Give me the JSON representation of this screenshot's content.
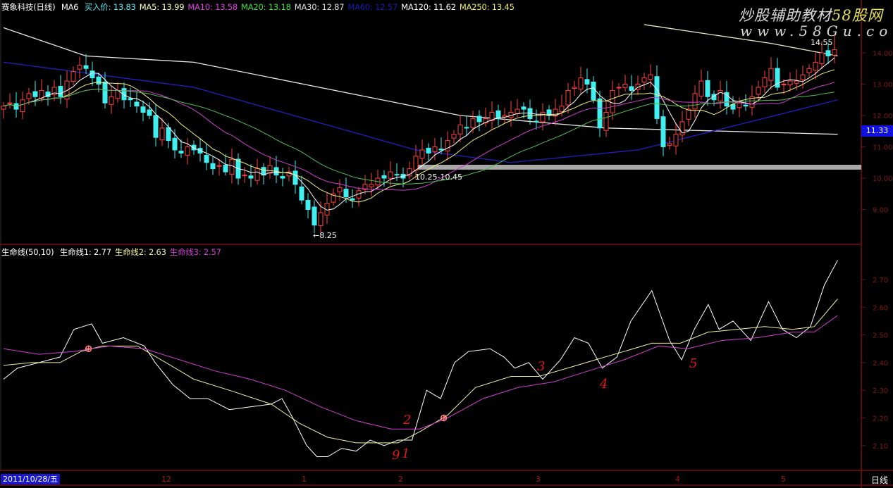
{
  "header": {
    "stock": "赛象科技(日线)",
    "indicator": "MA6",
    "items": [
      {
        "label": "买入价: 13.83",
        "color": "#60e8f0"
      },
      {
        "label": "MA5: 13.99",
        "color": "#ffffb0"
      },
      {
        "label": "MA10: 13.58",
        "color": "#e040e0"
      },
      {
        "label": "MA20: 13.18",
        "color": "#40e040"
      },
      {
        "label": "MA30: 12.87",
        "color": "#e0e0e0"
      },
      {
        "label": "MA60: 12.57",
        "color": "#1a1ab0"
      },
      {
        "label": "MA120: 11.62",
        "color": "#ffffff"
      },
      {
        "label": "MA250: 13.45",
        "color": "#f0f060"
      }
    ]
  },
  "lower_header": {
    "name": "生命线(50,10)",
    "items": [
      {
        "label": "生命线1: 2.77",
        "color": "#ffffff"
      },
      {
        "label": "生命线2: 2.63",
        "color": "#f0f0a0"
      },
      {
        "label": "生命线3: 2.57",
        "color": "#d040d0"
      }
    ]
  },
  "watermark": {
    "line1a": "炒股辅助教材",
    "line1b": "58股网",
    "line2": "www.58Gu.com"
  },
  "annotations": {
    "low_price": "←8.25",
    "high_price": "14.55",
    "band": "10.25-10.45",
    "last_price": "11.33",
    "marks": [
      "9",
      "1",
      "2",
      "3",
      "4",
      "5"
    ]
  },
  "bottom": {
    "date": "2011/10/28/五",
    "months": [
      "12",
      "1",
      "2",
      "3",
      "4",
      "5"
    ],
    "period": "日线"
  },
  "chart_data": [
    {
      "type": "candlestick",
      "title": "赛象科技(日线)",
      "ylim": [
        7.9,
        15.2
      ],
      "yticks": [
        "14.00",
        "13.00",
        "12.00",
        "11.00",
        "10.00",
        "9.00"
      ],
      "close": [
        12.3,
        12.4,
        12.2,
        12.5,
        12.7,
        12.6,
        12.8,
        12.6,
        12.9,
        12.6,
        13.1,
        13.4,
        13.6,
        13.5,
        13.2,
        13.0,
        12.4,
        12.6,
        12.8,
        12.5,
        12.5,
        12.3,
        12.1,
        12.0,
        11.3,
        11.6,
        11.2,
        10.9,
        10.8,
        11.0,
        10.9,
        10.8,
        10.5,
        10.3,
        10.4,
        10.2,
        10.6,
        10.0,
        10.1,
        10.0,
        10.3,
        10.1,
        10.4,
        10.1,
        10.0,
        10.2,
        9.8,
        9.3,
        9.0,
        8.5,
        8.9,
        9.2,
        9.5,
        9.7,
        9.4,
        9.3,
        9.6,
        9.8,
        9.8,
        10.0,
        10.0,
        10.2,
        10.1,
        10.0,
        10.3,
        10.7,
        10.9,
        10.8,
        11.0,
        10.9,
        11.2,
        11.4,
        11.7,
        11.6,
        11.9,
        11.8,
        11.9,
        12.1,
        11.9,
        12.0,
        12.1,
        12.2,
        12.2,
        11.9,
        11.8,
        12.1,
        12.0,
        12.2,
        12.3,
        12.8,
        12.9,
        13.2,
        13.0,
        12.5,
        11.6,
        12.1,
        12.8,
        12.9,
        13.0,
        12.8,
        13.0,
        13.2,
        13.3,
        11.9,
        11.0,
        11.1,
        11.4,
        11.8,
        12.2,
        12.7,
        13.1,
        12.6,
        12.5,
        12.8,
        12.3,
        12.2,
        12.4,
        12.3,
        12.6,
        12.9,
        13.2,
        13.5,
        12.9,
        13.0,
        13.1,
        13.1,
        13.3,
        13.5,
        13.7,
        14.0,
        13.9,
        14.1
      ],
      "ma_periods": [
        5,
        10,
        20,
        30
      ],
      "ma_colors": [
        "#ffffff",
        "#f0f080",
        "#d040d0",
        "#50c050"
      ],
      "long_lines": [
        {
          "name": "MA120",
          "color": "#e8e8e8",
          "points": [
            [
              0,
              14.8
            ],
            [
              13,
              13.9
            ],
            [
              30,
              13.7
            ],
            [
              72,
              12.0
            ],
            [
              95,
              11.6
            ],
            [
              131.5,
              11.4
            ]
          ]
        },
        {
          "name": "MA250",
          "color": "#e8e8c0",
          "points": [
            [
              101,
              14.9
            ],
            [
              121,
              14.3
            ],
            [
              131.5,
              13.9
            ]
          ]
        },
        {
          "name": "MA60",
          "color": "#2020c0",
          "points": [
            [
              0,
              13.7
            ],
            [
              30,
              12.9
            ],
            [
              65,
              10.9
            ],
            [
              80,
              10.5
            ],
            [
              100,
              10.9
            ],
            [
              131.5,
              12.5
            ]
          ]
        }
      ],
      "band": {
        "from": 10.25,
        "to": 10.45,
        "start_index": 65
      },
      "low": {
        "index": 49,
        "value": 8.25
      },
      "high": {
        "index": 131,
        "value": 14.55
      }
    },
    {
      "type": "line",
      "title": "生命线(50,10)",
      "ylim": [
        2.0,
        2.82
      ],
      "yticks": [
        "2.70",
        "2.60",
        "2.50",
        "2.40",
        "2.30",
        "2.20",
        "2.10"
      ],
      "series": [
        {
          "name": "生命线1",
          "color": "#ffffff",
          "points": [
            [
              0,
              2.34
            ],
            [
              2.2,
              2.38
            ],
            [
              5.6,
              2.4
            ],
            [
              8.9,
              2.42
            ],
            [
              11.1,
              2.52
            ],
            [
              13.9,
              2.54
            ],
            [
              15.6,
              2.47
            ],
            [
              18.9,
              2.49
            ],
            [
              22.2,
              2.46
            ],
            [
              23.9,
              2.4
            ],
            [
              26.7,
              2.32
            ],
            [
              29.4,
              2.27
            ],
            [
              32.2,
              2.27
            ],
            [
              35.6,
              2.23
            ],
            [
              38.9,
              2.24
            ],
            [
              42.2,
              2.25
            ],
            [
              43.9,
              2.27
            ],
            [
              45.6,
              2.2
            ],
            [
              47.8,
              2.1
            ],
            [
              49.4,
              2.06
            ],
            [
              51.1,
              2.06
            ],
            [
              53.3,
              2.09
            ],
            [
              55.6,
              2.08
            ],
            [
              57.8,
              2.12
            ],
            [
              60,
              2.1
            ],
            [
              62.2,
              2.12
            ],
            [
              64.4,
              2.12
            ],
            [
              66.7,
              2.3
            ],
            [
              68.9,
              2.27
            ],
            [
              71.1,
              2.4
            ],
            [
              73.3,
              2.44
            ],
            [
              76.7,
              2.45
            ],
            [
              78.9,
              2.42
            ],
            [
              80.6,
              2.38
            ],
            [
              82.8,
              2.4
            ],
            [
              85,
              2.34
            ],
            [
              87.8,
              2.41
            ],
            [
              90,
              2.49
            ],
            [
              92.2,
              2.47
            ],
            [
              94.4,
              2.38
            ],
            [
              96.7,
              2.42
            ],
            [
              98.9,
              2.55
            ],
            [
              102.2,
              2.66
            ],
            [
              105,
              2.48
            ],
            [
              106.9,
              2.41
            ],
            [
              108.9,
              2.52
            ],
            [
              111.1,
              2.61
            ],
            [
              112.8,
              2.52
            ],
            [
              115,
              2.55
            ],
            [
              117.8,
              2.48
            ],
            [
              120.6,
              2.62
            ],
            [
              122.8,
              2.52
            ],
            [
              125,
              2.49
            ],
            [
              127.2,
              2.53
            ],
            [
              129.4,
              2.68
            ],
            [
              131.5,
              2.77
            ]
          ]
        },
        {
          "name": "生命线2",
          "color": "#f0f0a0",
          "points": [
            [
              0,
              2.39
            ],
            [
              4.4,
              2.4
            ],
            [
              8.9,
              2.4
            ],
            [
              12.2,
              2.44
            ],
            [
              15.6,
              2.46
            ],
            [
              21.1,
              2.46
            ],
            [
              25.6,
              2.4
            ],
            [
              30,
              2.34
            ],
            [
              35.6,
              2.3
            ],
            [
              42.2,
              2.25
            ],
            [
              46.7,
              2.18
            ],
            [
              51.1,
              2.13
            ],
            [
              55.6,
              2.11
            ],
            [
              62.2,
              2.11
            ],
            [
              65.6,
              2.15
            ],
            [
              70,
              2.21
            ],
            [
              74.4,
              2.31
            ],
            [
              80,
              2.35
            ],
            [
              84.4,
              2.35
            ],
            [
              88.9,
              2.38
            ],
            [
              93.3,
              2.41
            ],
            [
              97.8,
              2.44
            ],
            [
              102.2,
              2.47
            ],
            [
              106.7,
              2.47
            ],
            [
              111.1,
              2.51
            ],
            [
              115.6,
              2.52
            ],
            [
              120,
              2.53
            ],
            [
              124.4,
              2.52
            ],
            [
              127.8,
              2.53
            ],
            [
              131.5,
              2.63
            ]
          ]
        },
        {
          "name": "生命线3",
          "color": "#d040d0",
          "points": [
            [
              0,
              2.45
            ],
            [
              5.6,
              2.43
            ],
            [
              11.1,
              2.44
            ],
            [
              16.7,
              2.46
            ],
            [
              22.2,
              2.45
            ],
            [
              27.8,
              2.41
            ],
            [
              33.3,
              2.37
            ],
            [
              38.9,
              2.34
            ],
            [
              44.4,
              2.3
            ],
            [
              50,
              2.24
            ],
            [
              55.6,
              2.19
            ],
            [
              61.1,
              2.16
            ],
            [
              65.6,
              2.16
            ],
            [
              70,
              2.2
            ],
            [
              75.6,
              2.27
            ],
            [
              81.1,
              2.31
            ],
            [
              86.7,
              2.33
            ],
            [
              92.2,
              2.37
            ],
            [
              97.8,
              2.41
            ],
            [
              103.3,
              2.46
            ],
            [
              107.8,
              2.45
            ],
            [
              113.3,
              2.48
            ],
            [
              118.9,
              2.49
            ],
            [
              124.4,
              2.51
            ],
            [
              127.8,
              2.51
            ],
            [
              131.5,
              2.57
            ]
          ]
        }
      ],
      "cross_markers": [
        [
          13.4,
          2.45
        ],
        [
          69.4,
          2.2
        ]
      ]
    }
  ]
}
